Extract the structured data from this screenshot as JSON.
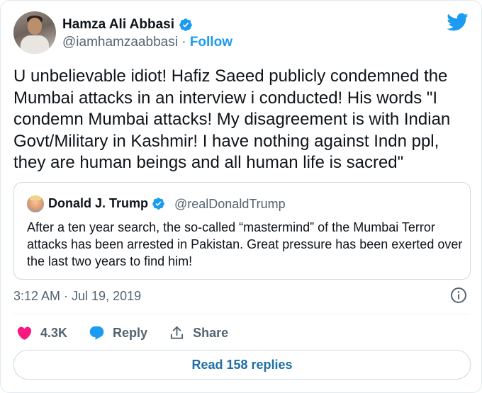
{
  "author": {
    "name": "Hamza Ali Abbasi",
    "handle": "@iamhamzaabbasi",
    "separator": "·",
    "follow_label": "Follow",
    "verified": true
  },
  "tweet": {
    "text": "U unbelievable idiot! Hafiz Saeed publicly condemned the Mumbai attacks in an interview i conducted! His words \"I condemn Mumbai attacks! My disagreement is with Indian Govt/Military in Kashmir! I have nothing against Indn ppl, they are human beings and all human life is sacred\"",
    "timestamp": "3:12 AM · Jul 19, 2019"
  },
  "quoted_tweet": {
    "name": "Donald J. Trump",
    "handle": "@realDonaldTrump",
    "verified": true,
    "text": "After a ten year search, the so-called “mastermind” of the Mumbai Terror attacks has been arrested in Pakistan. Great pressure has been exerted over the last two years to find him!"
  },
  "actions": {
    "likes": "4.3K",
    "reply_label": "Reply",
    "share_label": "Share"
  },
  "footer": {
    "read_replies_label": "Read 158 replies"
  },
  "colors": {
    "accent": "#1d9bf0",
    "like": "#f91880",
    "text": "#0f1419",
    "muted": "#536471"
  },
  "icons": [
    "twitter-bird-icon",
    "verified-badge-icon",
    "info-icon",
    "heart-icon",
    "reply-bubble-icon",
    "share-icon"
  ]
}
